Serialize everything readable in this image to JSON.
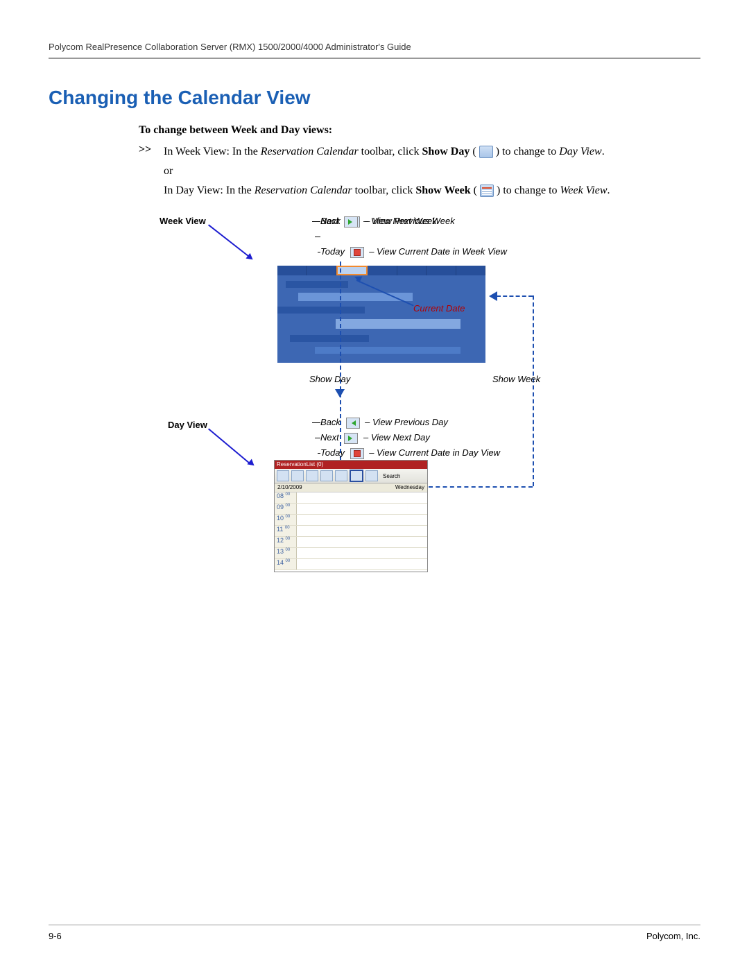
{
  "header": {
    "doc_title": "Polycom RealPresence Collaboration Server (RMX) 1500/2000/4000 Administrator's Guide"
  },
  "section_title": "Changing the Calendar View",
  "procedure_heading": "To change between Week and Day views:",
  "step_marker": ">>",
  "step1_a": "In Week View: In the ",
  "step1_b": "Reservation Calendar",
  "step1_c": " toolbar, click ",
  "step1_d": "Show Day",
  "step1_e": " ( ",
  "step1_f": " ) to change to ",
  "step1_g": "Day View",
  "step1_h": ".",
  "or_text": "or",
  "step2_a": "In Day View: In the ",
  "step2_b": "Reservation Calendar",
  "step2_c": " toolbar, click ",
  "step2_d": "Show Week",
  "step2_e": " ( ",
  "step2_f": " ) to change to ",
  "step2_g": "Week View",
  "step2_h": ".",
  "labels": {
    "week_view": "Week View",
    "day_view": "Day View",
    "back": "Back",
    "next": "Next",
    "today": "Today",
    "show_day": "Show Day",
    "show_week": "Show Week",
    "current_date": "Current Date"
  },
  "legend_week": {
    "back": "– View Previous Week",
    "next": "– View Next Week",
    "today": "– View Current Date in Week View"
  },
  "legend_day": {
    "back": "– View Previous Day",
    "next": "– View Next Day",
    "today": "– View Current Date in Day View"
  },
  "day_panel": {
    "title": "ReservationList (0)",
    "search": "Search",
    "date": "2/10/2009",
    "day_name": "Wednesday",
    "hours": [
      "08",
      "09",
      "10",
      "11",
      "12",
      "13",
      "14"
    ],
    "minute_suffix": "00"
  },
  "footer": {
    "page_num": "9-6",
    "company": "Polycom, Inc."
  }
}
